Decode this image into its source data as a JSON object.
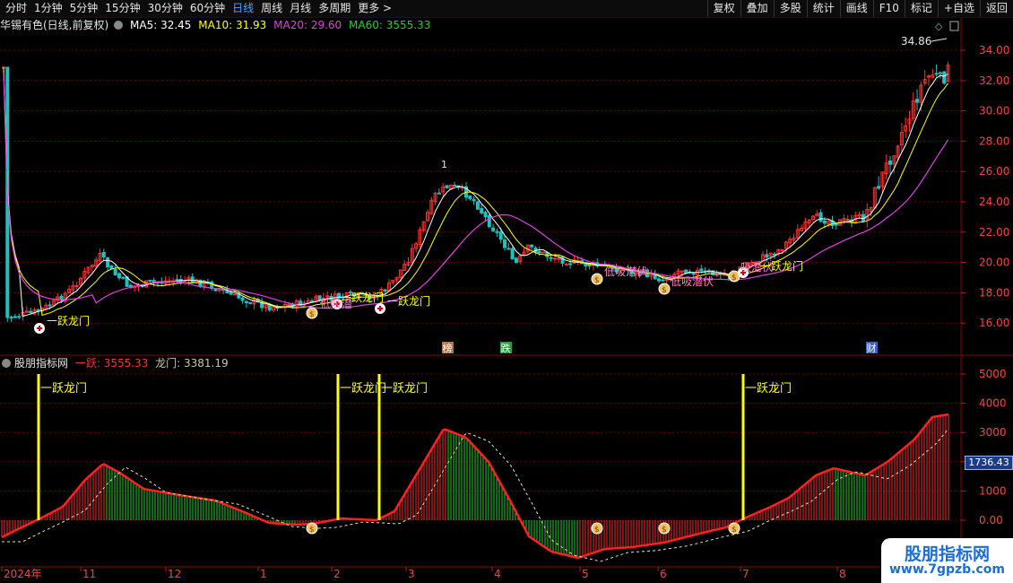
{
  "tabs": [
    "分时",
    "1分钟",
    "5分钟",
    "15分钟",
    "30分钟",
    "60分钟",
    "日线",
    "周线",
    "月线",
    "多周期",
    "更多 >"
  ],
  "active_tab": "日线",
  "tools": [
    "复权",
    "叠加",
    "多股",
    "统计",
    "画线",
    "F10",
    "标记",
    "+自选",
    "返回"
  ],
  "info": {
    "stock": "华锡有色(日线,前复权)",
    "ma5": "MA5: 32.45",
    "ma10": "MA10: 31.93",
    "ma20": "MA20: 29.60",
    "ma60": "MA60: 3555.33"
  },
  "indicator": {
    "name": "股朋指标网",
    "yiyue": "一跃: 3555.33",
    "longmen": "龙门: 3381.19"
  },
  "price_axis": [
    "34.00",
    "32.00",
    "30.00",
    "28.00",
    "26.00",
    "24.00",
    "22.00",
    "20.00",
    "18.00",
    "16.00"
  ],
  "ind_axis": [
    "5000",
    "4000",
    "3000",
    "2000",
    "1000",
    "0.00"
  ],
  "value_box": "1736.43",
  "high_label": "34.86",
  "peak_mark": "1",
  "date_axis": [
    "2024年",
    "11",
    "12",
    "1",
    "2",
    "3",
    "4",
    "5",
    "6",
    "7",
    "8"
  ],
  "event_tags": [
    "榜",
    "跌",
    "财"
  ],
  "signal_labels": {
    "jump": "一跃龙门",
    "buy": "低吸潜伏",
    "buy2": "低吸潜",
    "buy3": "低吸潜伏",
    "buy4": "吸潜伏",
    "buy5": "低吸潜伏",
    "buy6": "低吸潜伏"
  },
  "watermark": {
    "title": "股朋指标网",
    "url": "www.7gpzb.com"
  },
  "colors": {
    "up": "#ff3030",
    "down": "#20c0c0",
    "ma5": "#ffffff",
    "ma10": "#ffff00",
    "ma20": "#e040e0",
    "ma60": "#20d020",
    "grid": "#6a0000",
    "jump": "#ffff00"
  }
}
